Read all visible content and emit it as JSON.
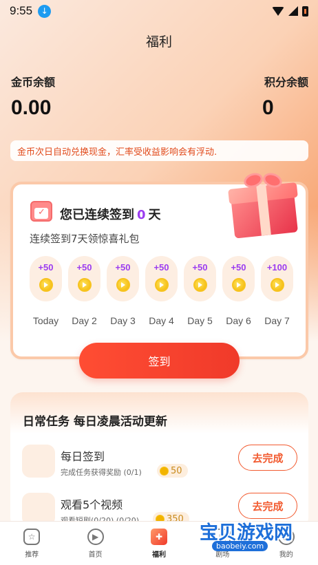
{
  "status": {
    "time": "9:55"
  },
  "page": {
    "title": "福利"
  },
  "balance": {
    "coin_label": "金币余额",
    "coin_value": "0.00",
    "point_label": "积分余额",
    "point_value": "0"
  },
  "notice": "金币次日自动兑换现金，汇率受收益影响会有浮动.",
  "checkin": {
    "streak_prefix": "您已连续签到",
    "streak_count": "0",
    "streak_suffix": "天",
    "subtitle": "连续签到7天领惊喜礼包",
    "days": [
      {
        "reward": "+50",
        "label": "Today"
      },
      {
        "reward": "+50",
        "label": "Day 2"
      },
      {
        "reward": "+50",
        "label": "Day 3"
      },
      {
        "reward": "+50",
        "label": "Day 4"
      },
      {
        "reward": "+50",
        "label": "Day 5"
      },
      {
        "reward": "+50",
        "label": "Day 6"
      },
      {
        "reward": "+100",
        "label": "Day 7"
      }
    ],
    "button_label": "签到"
  },
  "tasks": {
    "title": "日常任务  每日凌晨活动更新",
    "items": [
      {
        "name": "每日签到",
        "desc": "完成任务获得奖励 (0/1)",
        "reward": "50",
        "button": "去完成"
      },
      {
        "name": "观看5个视频",
        "desc": "观看短剧(0/20) (0/20)",
        "reward": "350",
        "button": "去完成"
      }
    ]
  },
  "nav": {
    "items": [
      {
        "label": "推荐",
        "icon": "star-icon"
      },
      {
        "label": "首页",
        "icon": "play-icon"
      },
      {
        "label": "福利",
        "icon": "gift-icon"
      },
      {
        "label": "剧场",
        "icon": "theater-icon"
      },
      {
        "label": "我的",
        "icon": "profile-icon"
      }
    ],
    "active_index": 2
  },
  "watermark": {
    "text": "宝贝游戏网",
    "url": "baobeiy.com"
  },
  "colors": {
    "accent": "#f03a2a",
    "reward_purple": "#9b3cf0",
    "notice_text": "#e14a1b"
  }
}
